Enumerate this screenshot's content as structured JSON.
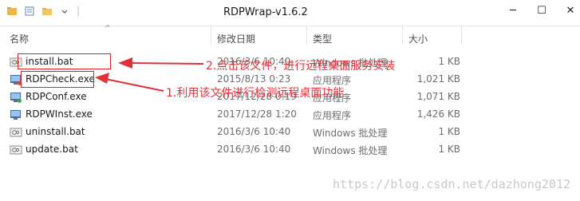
{
  "window": {
    "title": "RDPWrap-v1.6.2"
  },
  "header": {
    "name": "名称",
    "date": "修改日期",
    "type": "类型",
    "size": "大小"
  },
  "files": [
    {
      "name": "install.bat",
      "date": "2016/3/6 10:40",
      "type": "Windows 批处理",
      "size": "1 KB",
      "icon": "bat-icon"
    },
    {
      "name": "RDPCheck.exe",
      "date": "2015/8/13 0:23",
      "type": "应用程序",
      "size": "1,021 KB",
      "icon": "exe-icon"
    },
    {
      "name": "RDPConf.exe",
      "date": "2017/12/28 0:19",
      "type": "应用程序",
      "size": "1,071 KB",
      "icon": "exe-icon"
    },
    {
      "name": "RDPWInst.exe",
      "date": "2017/12/28 1:20",
      "type": "应用程序",
      "size": "1,426 KB",
      "icon": "exe-icon"
    },
    {
      "name": "uninstall.bat",
      "date": "2016/3/6 10:40",
      "type": "Windows 批处理",
      "size": "1 KB",
      "icon": "bat-icon"
    },
    {
      "name": "update.bat",
      "date": "2016/3/6 10:40",
      "type": "Windows 批处理",
      "size": "1 KB",
      "icon": "bat-icon"
    }
  ],
  "annotations": {
    "install": "2.点击该文件，进行远程桌面服务安装",
    "check": "1.利用该文件进行检测远程桌面功能"
  },
  "watermark": "https://blog.csdn.net/dazhong2012",
  "colors": {
    "annotation": "#e0303a",
    "box": "#e02020"
  }
}
